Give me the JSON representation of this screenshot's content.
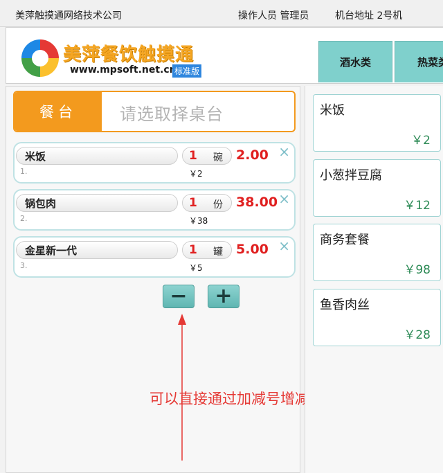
{
  "topbar": {
    "company": "美萍触摸通网络技术公司",
    "operator": "操作人员 管理员",
    "machine": "机台地址  2号机"
  },
  "header": {
    "logo_title": "美萍餐饮触摸通",
    "logo_url": "www.mpsoft.net.cn",
    "logo_badge": "标准版",
    "tabs": [
      {
        "label": "酒水类"
      },
      {
        "label": "热菜类"
      }
    ]
  },
  "table_select": {
    "button_label": "餐台",
    "placeholder": "请选取择桌台"
  },
  "order_items": [
    {
      "index": "1.",
      "name": "米饭",
      "qty": "1",
      "unit": "碗",
      "unit_price": "￥2",
      "total": "2.00"
    },
    {
      "index": "2.",
      "name": "锅包肉",
      "qty": "1",
      "unit": "份",
      "unit_price": "￥38",
      "total": "38.00"
    },
    {
      "index": "3.",
      "name": "金星新一代",
      "qty": "1",
      "unit": "罐",
      "unit_price": "￥5",
      "total": "5.00"
    }
  ],
  "controls": {
    "minus": "−",
    "plus": "+",
    "remove_symbol": "×"
  },
  "hint": "可以直接通过加减号增减菜品数量",
  "dishes": [
    {
      "name": "米饭",
      "price": "￥2"
    },
    {
      "name": "小葱拌豆腐",
      "price": "￥12"
    },
    {
      "name": "商务套餐",
      "price": "￥98"
    },
    {
      "name": "鱼香肉丝",
      "price": "￥28"
    }
  ],
  "colors": {
    "accent_orange": "#f39a1e",
    "tab_teal": "#7fd0cc",
    "price_red": "#e02020",
    "price_green": "#2e8b57",
    "hint_red": "#e53935"
  }
}
